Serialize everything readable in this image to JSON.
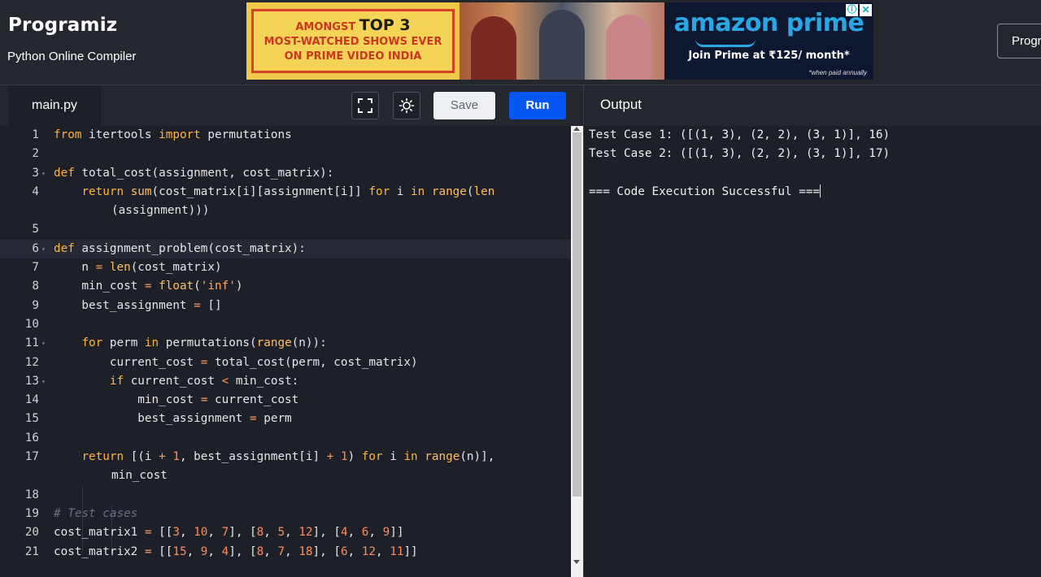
{
  "header": {
    "logo": "Programiz",
    "subtitle": "Python Online Compiler",
    "pro_button": "Progr"
  },
  "ad": {
    "line1_small": "AMONGST",
    "line1_big": "TOP 3",
    "line2": "MOST-WATCHED SHOWS EVER",
    "line3": "ON PRIME VIDEO INDIA",
    "brand": "amazon prime",
    "offer": "Join Prime at ₹125/ month*",
    "note": "*when paid annually"
  },
  "editor": {
    "tab_name": "main.py",
    "save_label": "Save",
    "run_label": "Run",
    "fullscreen_icon": "fullscreen-icon",
    "theme_icon": "sun-icon"
  },
  "output": {
    "title": "Output",
    "lines": [
      "Test Case 1: ([(1, 3), (2, 2), (3, 1)], 16)",
      "Test Case 2: ([(1, 3), (2, 2), (3, 1)], 17)",
      "",
      "=== Code Execution Successful ==="
    ]
  },
  "colors": {
    "background": "#1e2029",
    "header": "#25272f",
    "run_button": "#0556f3",
    "keyword": "#ffb33b",
    "number": "#ff8c5a"
  }
}
